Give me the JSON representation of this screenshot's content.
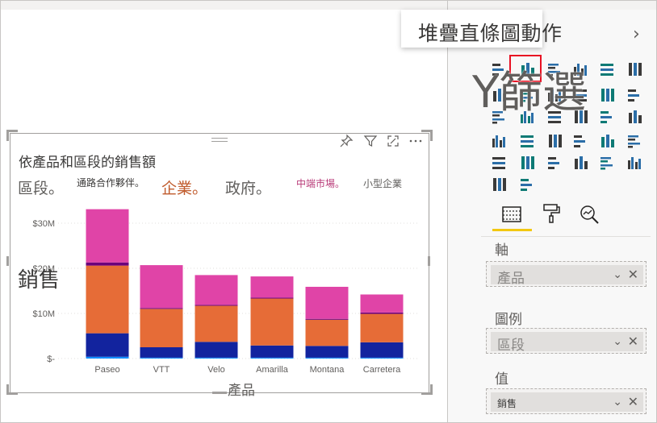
{
  "tooltip": {
    "text": "堆疊直條圖動作"
  },
  "pane": {
    "big_overlay_text": "Y篩選",
    "axis_label": "軸",
    "axis_field": "產品",
    "legend_label": "圖例",
    "legend_field": "區段",
    "values_label": "值",
    "values_field": "銷售"
  },
  "visual": {
    "title": "依產品和區段的銷售額",
    "legend": [
      {
        "label": "區段。",
        "color": "#605e5c",
        "size": "large"
      },
      {
        "label": "通路合作夥伴。",
        "color": "#3b3a39",
        "size": "small"
      },
      {
        "label": "企業。",
        "color": "#c05a2b",
        "size": "large"
      },
      {
        "label": "政府。",
        "color": "#605e5c",
        "size": "large"
      },
      {
        "label": "中端市場。",
        "color": "#b83a78",
        "size": "small"
      },
      {
        "label": "小型企業",
        "color": "#605e5c",
        "size": "small"
      }
    ],
    "y_axis_overlay_label": "銷售",
    "x_axis_label": "產品"
  },
  "chart_data": {
    "type": "bar",
    "stacked": true,
    "title": "依產品和區段的銷售額",
    "xlabel": "產品",
    "ylabel": "銷售",
    "categories": [
      "Paseo",
      "VTT",
      "Velo",
      "Amarilla",
      "Montana",
      "Carretera"
    ],
    "y_ticks": [
      "$-",
      "$10M",
      "$20M",
      "$30M"
    ],
    "ylim": [
      0,
      35
    ],
    "series": [
      {
        "color": "#118dff",
        "values": [
          0.4,
          0.2,
          0.2,
          0.2,
          0.2,
          0.2
        ]
      },
      {
        "color": "#12239e",
        "values": [
          5.2,
          2.3,
          3.5,
          2.7,
          2.6,
          3.4
        ]
      },
      {
        "color": "#e66c37",
        "values": [
          15.0,
          8.5,
          8.0,
          10.4,
          5.8,
          6.3
        ]
      },
      {
        "color": "#6b007b",
        "values": [
          0.7,
          0.2,
          0.2,
          0.2,
          0.2,
          0.3
        ]
      },
      {
        "color": "#e044a7",
        "values": [
          11.8,
          9.5,
          6.6,
          4.7,
          7.1,
          4.0
        ]
      }
    ]
  }
}
